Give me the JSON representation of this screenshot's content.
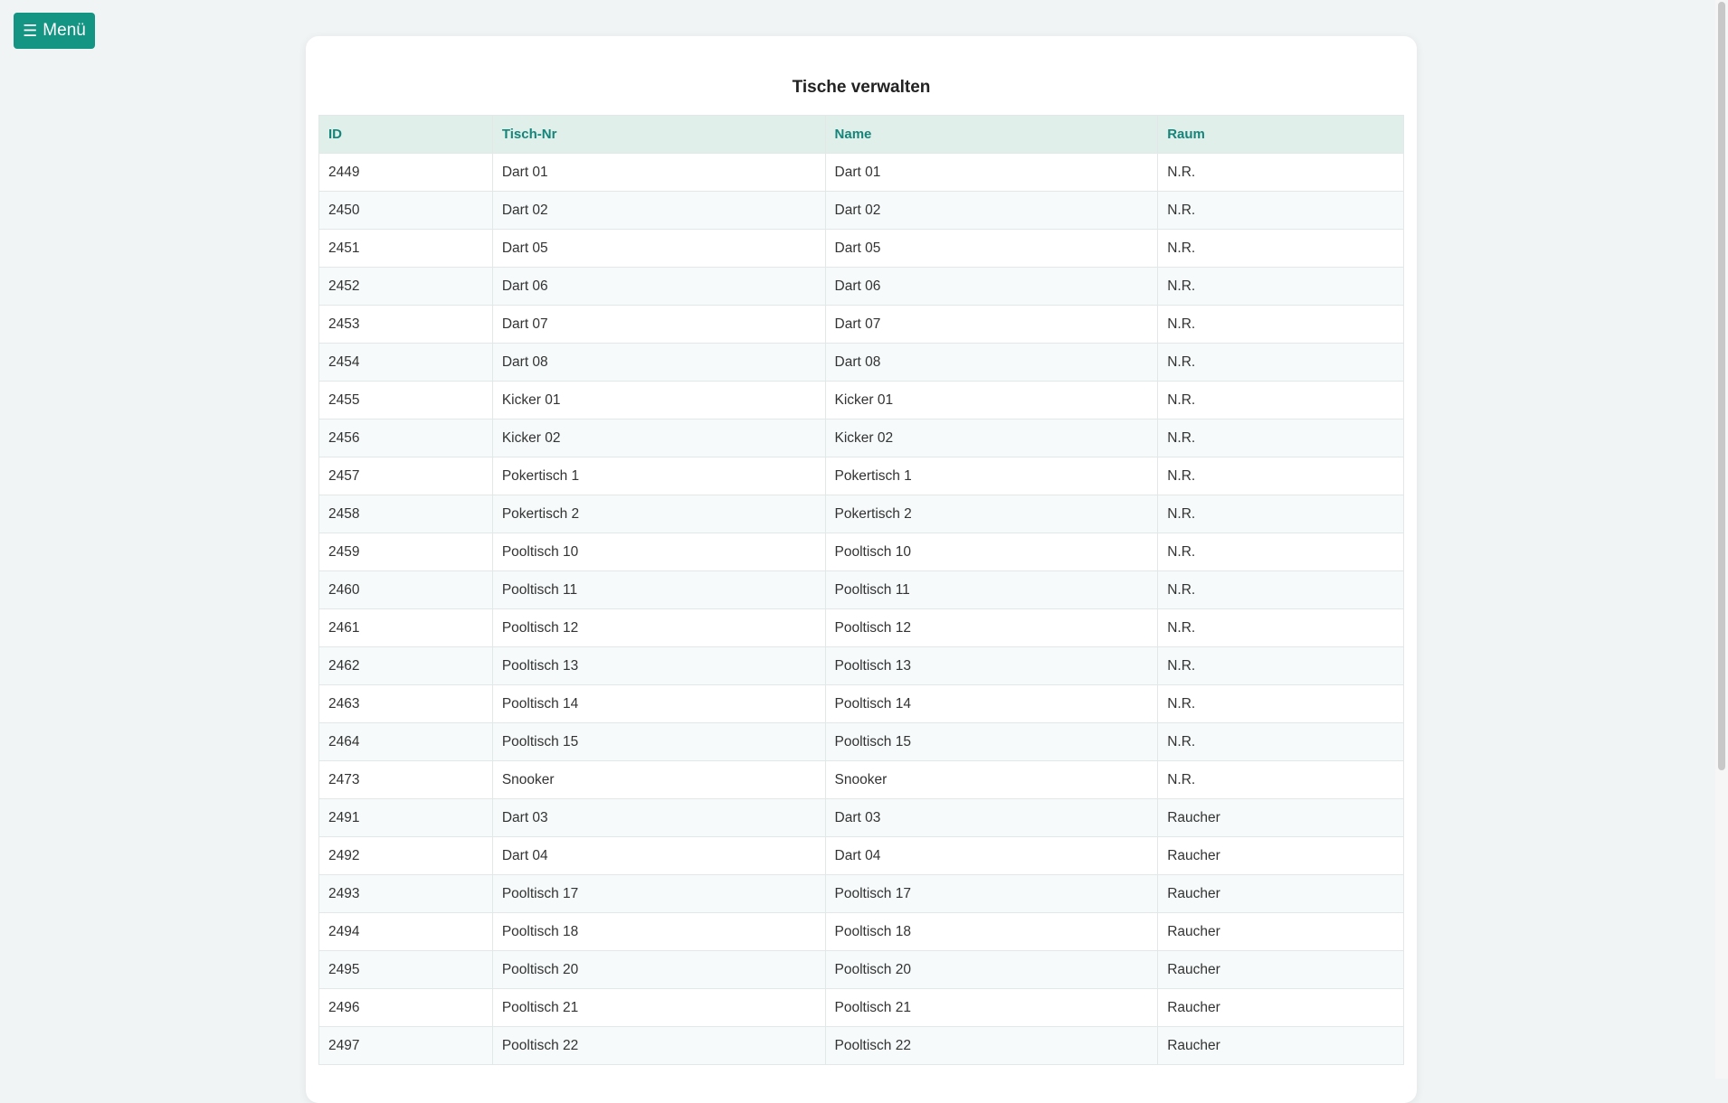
{
  "menu": {
    "icon": "hamburger-icon",
    "glyph": "☰",
    "label": "Menü"
  },
  "page": {
    "title": "Tische verwalten"
  },
  "accent": "#149584",
  "table": {
    "headers": [
      "ID",
      "Tisch-Nr",
      "Name",
      "Raum"
    ],
    "rows": [
      [
        "2449",
        "Dart 01",
        "Dart 01",
        "N.R."
      ],
      [
        "2450",
        "Dart 02",
        "Dart 02",
        "N.R."
      ],
      [
        "2451",
        "Dart 05",
        "Dart 05",
        "N.R."
      ],
      [
        "2452",
        "Dart 06",
        "Dart 06",
        "N.R."
      ],
      [
        "2453",
        "Dart 07",
        "Dart 07",
        "N.R."
      ],
      [
        "2454",
        "Dart 08",
        "Dart 08",
        "N.R."
      ],
      [
        "2455",
        "Kicker 01",
        "Kicker 01",
        "N.R."
      ],
      [
        "2456",
        "Kicker 02",
        "Kicker 02",
        "N.R."
      ],
      [
        "2457",
        "Pokertisch 1",
        "Pokertisch 1",
        "N.R."
      ],
      [
        "2458",
        "Pokertisch 2",
        "Pokertisch 2",
        "N.R."
      ],
      [
        "2459",
        "Pooltisch 10",
        "Pooltisch 10",
        "N.R."
      ],
      [
        "2460",
        "Pooltisch 11",
        "Pooltisch 11",
        "N.R."
      ],
      [
        "2461",
        "Pooltisch 12",
        "Pooltisch 12",
        "N.R."
      ],
      [
        "2462",
        "Pooltisch 13",
        "Pooltisch 13",
        "N.R."
      ],
      [
        "2463",
        "Pooltisch 14",
        "Pooltisch 14",
        "N.R."
      ],
      [
        "2464",
        "Pooltisch 15",
        "Pooltisch 15",
        "N.R."
      ],
      [
        "2473",
        "Snooker",
        "Snooker",
        "N.R."
      ],
      [
        "2491",
        "Dart 03",
        "Dart 03",
        "Raucher"
      ],
      [
        "2492",
        "Dart 04",
        "Dart 04",
        "Raucher"
      ],
      [
        "2493",
        "Pooltisch 17",
        "Pooltisch 17",
        "Raucher"
      ],
      [
        "2494",
        "Pooltisch 18",
        "Pooltisch 18",
        "Raucher"
      ],
      [
        "2495",
        "Pooltisch 20",
        "Pooltisch 20",
        "Raucher"
      ],
      [
        "2496",
        "Pooltisch 21",
        "Pooltisch 21",
        "Raucher"
      ],
      [
        "2497",
        "Pooltisch 22",
        "Pooltisch 22",
        "Raucher"
      ]
    ]
  }
}
